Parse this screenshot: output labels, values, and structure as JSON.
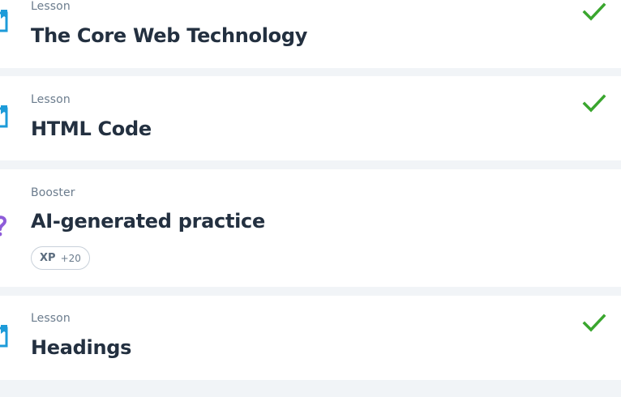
{
  "items": [
    {
      "kind": "Lesson",
      "title": "The Core Web Technology",
      "completed": true,
      "icon": "lesson-bookmark-icon"
    },
    {
      "kind": "Lesson",
      "title": "HTML Code",
      "completed": true,
      "icon": "lesson-bookmark-icon"
    },
    {
      "kind": "Booster",
      "title": "AI-generated practice",
      "completed": false,
      "icon": "booster-question-icon",
      "xp": {
        "tag": "XP",
        "value": "+20"
      }
    },
    {
      "kind": "Lesson",
      "title": "Headings",
      "completed": true,
      "icon": "lesson-bookmark-icon"
    }
  ],
  "colors": {
    "page_bg": "#f1f4f7",
    "card_bg": "#ffffff",
    "title": "#233040",
    "kind": "#6b7c8d",
    "lesson_icon": "#1d9bd9",
    "booster_icon": "#8e5cd9",
    "check": "#3aa62e"
  }
}
